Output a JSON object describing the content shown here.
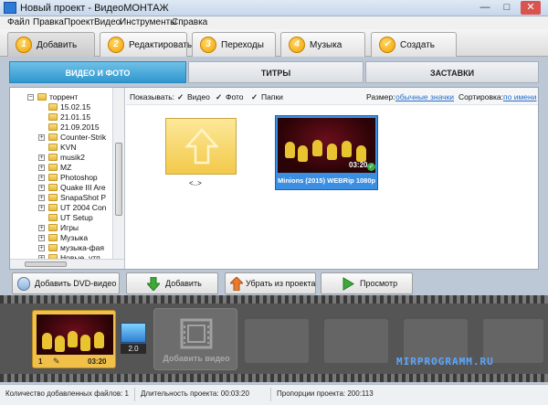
{
  "window": {
    "title": "Новый проект - ВидеоМОНТАЖ",
    "minimize": "—",
    "maximize": "□",
    "close": "✕"
  },
  "menu": [
    "Файл",
    "Правка",
    "Проект",
    "Видео",
    "Инструменты",
    "Справка"
  ],
  "steps": [
    {
      "num": "1",
      "label": "Добавить"
    },
    {
      "num": "2",
      "label": "Редактировать"
    },
    {
      "num": "3",
      "label": "Переходы"
    },
    {
      "num": "4",
      "label": "Музыка"
    },
    {
      "num": "✓",
      "label": "Создать"
    }
  ],
  "subtabs": [
    "ВИДЕО И ФОТО",
    "ТИТРЫ",
    "ЗАСТАВКИ"
  ],
  "tree": [
    {
      "label": "торрент",
      "expander": "−"
    },
    {
      "label": "15.02.15",
      "expander": ""
    },
    {
      "label": "21.01.15",
      "expander": ""
    },
    {
      "label": "21.09.2015",
      "expander": ""
    },
    {
      "label": "Counter-Strik",
      "expander": "+"
    },
    {
      "label": "KVN",
      "expander": ""
    },
    {
      "label": "musik2",
      "expander": "+"
    },
    {
      "label": "MZ",
      "expander": "+"
    },
    {
      "label": "Photoshop",
      "expander": "+"
    },
    {
      "label": "Quake III Are",
      "expander": "+"
    },
    {
      "label": "SnapaShot P",
      "expander": "+"
    },
    {
      "label": "UT 2004 Con",
      "expander": "+"
    },
    {
      "label": "UT Setup",
      "expander": ""
    },
    {
      "label": "Игры",
      "expander": "+"
    },
    {
      "label": "Музыка",
      "expander": "+"
    },
    {
      "label": "музыка-фая",
      "expander": "+"
    },
    {
      "label": "Новые_утп",
      "expander": "+"
    }
  ],
  "filter": {
    "show_label": "Показывать:",
    "video": "Видео",
    "photo": "Фото",
    "folders": "Папки",
    "check": "✓",
    "size_label": "Размер:",
    "size_value": "обычные значки",
    "sort_label": "Сортировка:",
    "sort_value": "по имени"
  },
  "files": {
    "back_label": "<..>",
    "video_name": "Minions (2015) WEBRip 1080p ...",
    "video_duration": "03:20",
    "video_badge": "✓"
  },
  "actions": {
    "add_dvd": "Добавить DVD-видео",
    "add": "Добавить",
    "remove": "Убрать из проекта",
    "preview": "Просмотр"
  },
  "timeline": {
    "clip_num": "1",
    "clip_edit": "✎",
    "clip_duration": "03:20",
    "transition_duration": "2.0",
    "add_video": "Добавить видео",
    "watermark": "MIRPROGRAMM.RU"
  },
  "status": {
    "files_count": "Количество добавленных файлов: 1",
    "duration": "Длительность проекта: 00:03:20",
    "ratio": "Пропорции проекта: 200:113"
  },
  "colors": {
    "accent": "#2f97cf",
    "step_icon": "#f0a400",
    "clip_frame": "#f1c048"
  }
}
